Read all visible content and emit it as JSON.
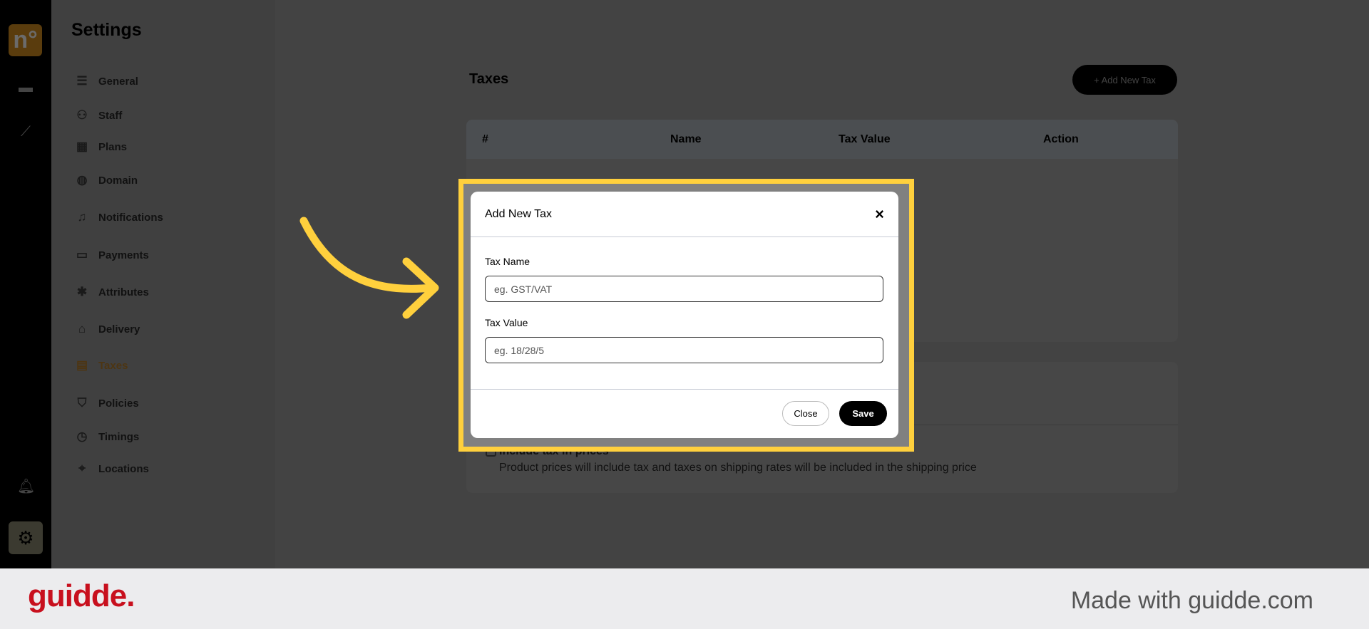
{
  "rail": {
    "logo": "n°",
    "icons": [
      "store-icon",
      "chart-icon",
      "bell-icon",
      "gear-icon"
    ]
  },
  "settings": {
    "title": "Settings",
    "active": "Taxes",
    "items": [
      {
        "label": "General",
        "icon": "sliders-icon",
        "glyph": "☰"
      },
      {
        "label": "Staff",
        "icon": "users-icon",
        "glyph": "⚇"
      },
      {
        "label": "Plans",
        "icon": "plans-icon",
        "glyph": "▦"
      },
      {
        "label": "Domain",
        "icon": "globe-icon",
        "glyph": "◍"
      },
      {
        "label": "Notifications",
        "icon": "bell-icon",
        "glyph": "♫"
      },
      {
        "label": "Payments",
        "icon": "wallet-icon",
        "glyph": "▭"
      },
      {
        "label": "Attributes",
        "icon": "snowflake-icon",
        "glyph": "✱"
      },
      {
        "label": "Delivery",
        "icon": "bag-icon",
        "glyph": "⌂"
      },
      {
        "label": "Taxes",
        "icon": "receipt-icon",
        "glyph": "▤"
      },
      {
        "label": "Policies",
        "icon": "shield-icon",
        "glyph": "⛉"
      },
      {
        "label": "Timings",
        "icon": "clock-icon",
        "glyph": "◷"
      },
      {
        "label": "Locations",
        "icon": "location-icon",
        "glyph": "⌖"
      }
    ]
  },
  "main": {
    "title": "Taxes",
    "add_button": "+ Add New Tax",
    "table": {
      "columns": [
        "#",
        "Name",
        "Tax Value",
        "Action"
      ]
    },
    "include_tax": {
      "label": "Include tax in prices",
      "description": "Product prices will include tax and taxes on shipping rates will be included in the shipping price"
    }
  },
  "modal": {
    "title": "Add New Tax",
    "close_icon": "×",
    "fields": [
      {
        "label": "Tax Name",
        "placeholder": "eg. GST/VAT",
        "value": ""
      },
      {
        "label": "Tax Value",
        "placeholder": "eg. 18/28/5",
        "value": ""
      }
    ],
    "close_label": "Close",
    "save_label": "Save"
  },
  "highlight_color": "#ffd03d",
  "footer": {
    "logo": "guidde.",
    "tagline": "Made with guidde.com"
  }
}
